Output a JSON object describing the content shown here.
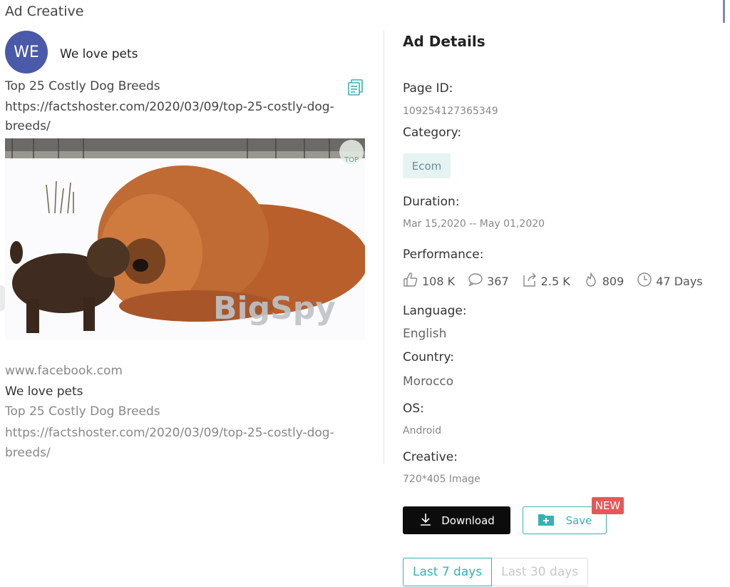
{
  "header": {
    "title": "Ad Creative"
  },
  "advertiser": {
    "initials": "WE",
    "name": "We love pets"
  },
  "ad": {
    "title": "Top 25 Costly Dog Breeds",
    "url": "https://factshoster.com/2020/03/09/top-25-costly-dog-breeds/",
    "image_watermark": "BigSpy",
    "image_corner_badge": "TOP"
  },
  "link_preview": {
    "domain": "www.facebook.com",
    "name": "We love pets",
    "title": "Top 25 Costly Dog Breeds",
    "url": "https://factshoster.com/2020/03/09/top-25-costly-dog-breeds/"
  },
  "details": {
    "title": "Ad Details",
    "page_id_label": "Page ID:",
    "page_id": "109254127365349",
    "category_label": "Category:",
    "category": "Ecom",
    "duration_label": "Duration:",
    "duration": "Mar 15,2020 -- May 01,2020",
    "performance_label": "Performance:",
    "performance": {
      "likes": "108 K",
      "comments": "367",
      "shares": "2.5 K",
      "hot": "809",
      "days": "47 Days"
    },
    "language_label": "Language:",
    "language": "English",
    "country_label": "Country:",
    "country": "Morocco",
    "os_label": "OS:",
    "os": "Android",
    "creative_label": "Creative:",
    "creative": "720*405 Image"
  },
  "actions": {
    "download": "Download",
    "save": "Save",
    "new_badge": "NEW"
  },
  "ranges": {
    "active": "Last 7 days",
    "inactive": "Last 30 days"
  },
  "colors": {
    "accent": "#36b1b3",
    "avatar": "#4a5aa8",
    "badge": "#e45858",
    "tag_bg": "#e5f3f3"
  },
  "icons": [
    "copy-icon",
    "thumbs-up-icon",
    "comment-icon",
    "share-icon",
    "flame-icon",
    "clock-icon",
    "download-icon",
    "folder-plus-icon"
  ]
}
